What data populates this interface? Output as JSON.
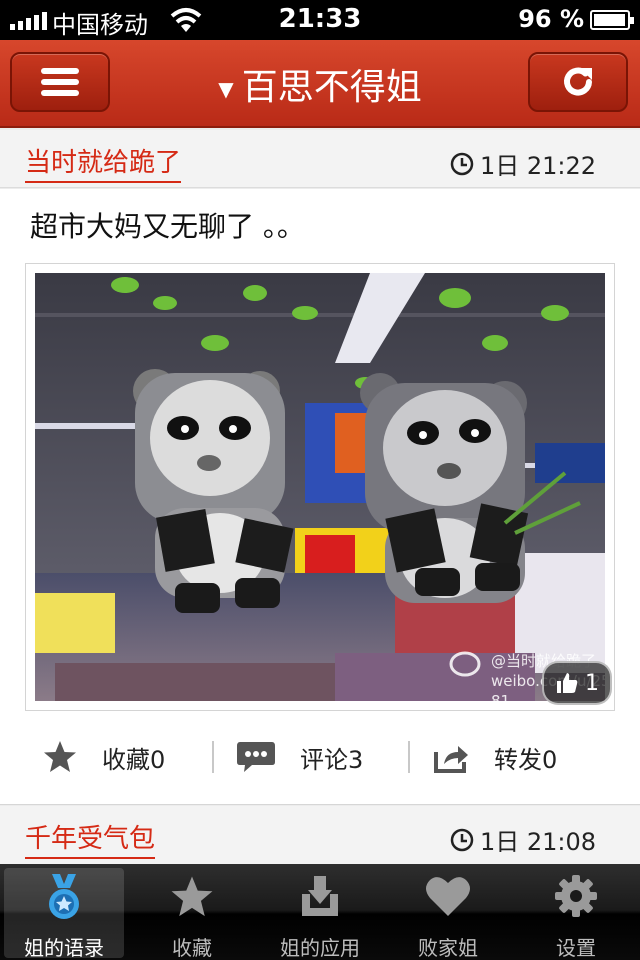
{
  "status_bar": {
    "carrier": "中国移动",
    "time": "21:33",
    "battery_percent": "96 %",
    "battery_level": 0.96
  },
  "nav": {
    "title": "百思不得姐",
    "menu_icon": "hamburger-icon",
    "refresh_icon": "refresh-icon"
  },
  "posts": [
    {
      "author": "当时就给跪了",
      "time": "1日 21:22",
      "text": "超市大妈又无聊了 。。",
      "image_watermark": [
        "@当时就给跪了",
        "weibo.com/u/255 81"
      ],
      "likes": "1",
      "actions": [
        {
          "label": "收藏0",
          "icon": "star-icon"
        },
        {
          "label": "评论3",
          "icon": "comment-icon"
        },
        {
          "label": "转发0",
          "icon": "share-icon"
        }
      ]
    },
    {
      "author": "千年受气包",
      "time": "1日 21:08"
    }
  ],
  "tabbar": [
    {
      "label": "姐的语录",
      "icon": "medal-icon",
      "active": true
    },
    {
      "label": "收藏",
      "icon": "star-icon",
      "active": false
    },
    {
      "label": "姐的应用",
      "icon": "download-icon",
      "active": false
    },
    {
      "label": "败家姐",
      "icon": "heart-icon",
      "active": false
    },
    {
      "label": "设置",
      "icon": "gear-icon",
      "active": false
    }
  ],
  "colors": {
    "brand_red": "#c4321b",
    "author_red": "#d52a15"
  }
}
